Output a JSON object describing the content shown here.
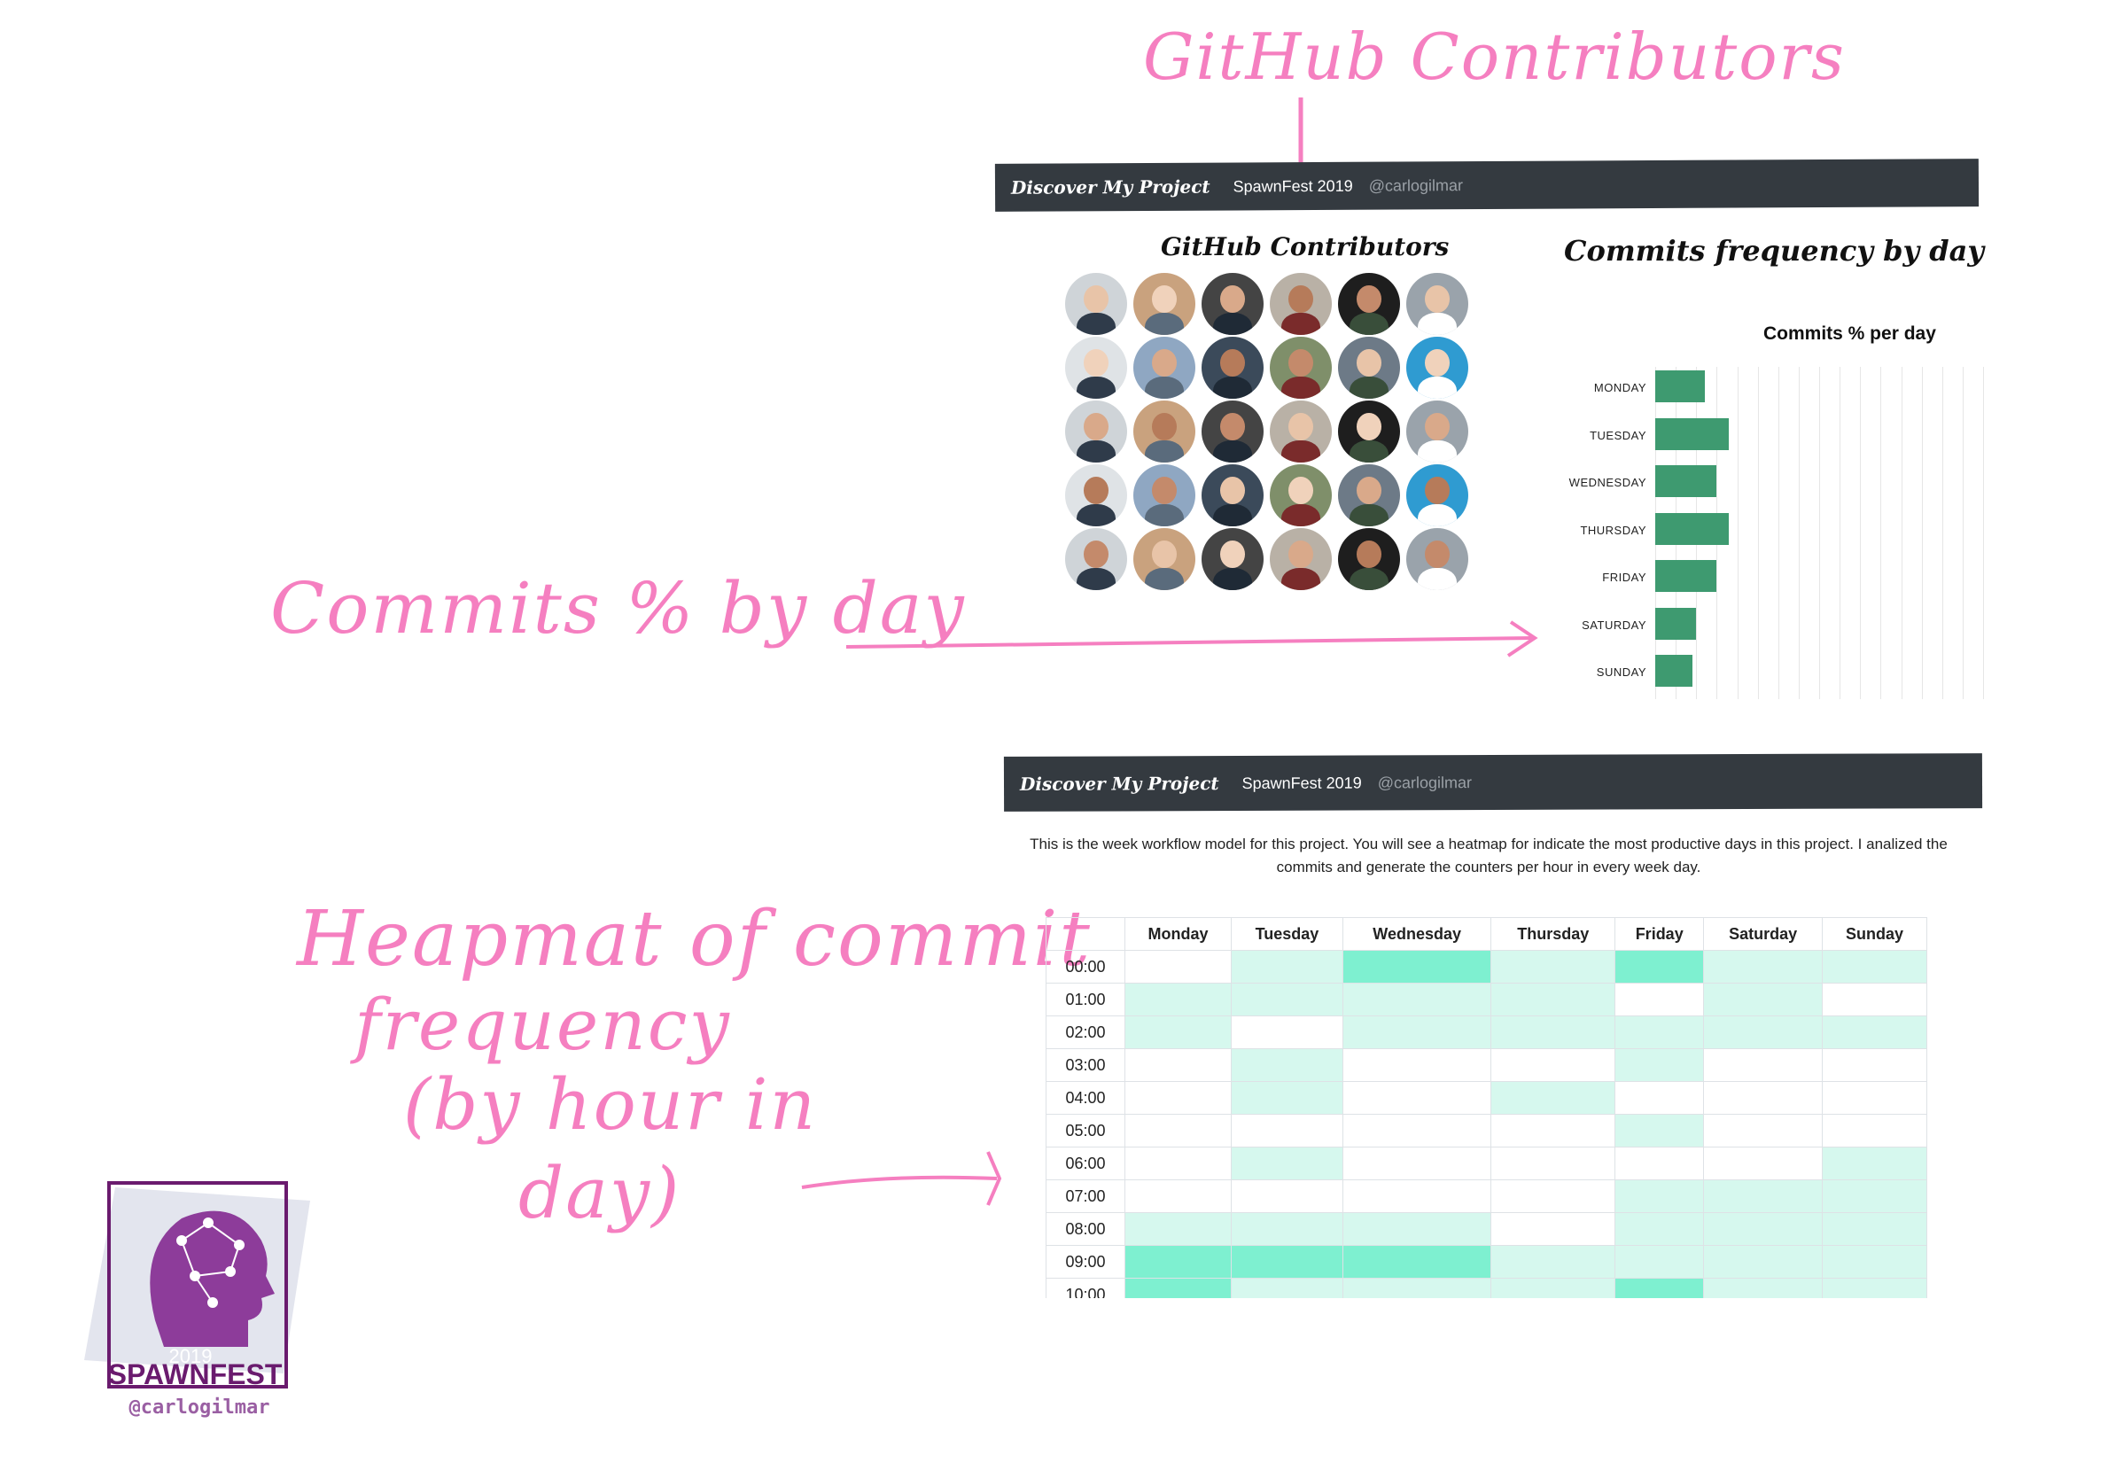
{
  "annotations": {
    "contributors_title": "GitHub Contributors",
    "commits_by_day": "Commits % by day",
    "heatmap_line1": "Heapmat of commit",
    "heatmap_line2": "frequency",
    "heatmap_line3": "(by hour in",
    "heatmap_line4": "day)"
  },
  "navbar": {
    "brand": "Discover My Project",
    "link1": "SpawnFest 2019",
    "link2": "@carlogilmar"
  },
  "contributors": {
    "title": "GitHub Contributors",
    "count": 30
  },
  "commits_panel": {
    "title": "Commits frequency by day"
  },
  "chart_data": {
    "type": "bar",
    "title": "Commits % per day",
    "orientation": "horizontal",
    "categories": [
      "MONDAY",
      "TUESDAY",
      "WEDNESDAY",
      "THURSDAY",
      "FRIDAY",
      "SATURDAY",
      "SUNDAY"
    ],
    "values": [
      12,
      18,
      15,
      18,
      15,
      10,
      9
    ],
    "xlim": [
      0,
      80
    ],
    "grid": true,
    "color": "#3e9a70"
  },
  "heatmap": {
    "intro": "This is the week workflow model for this project. You will see a heatmap for indicate the most productive days in this project. I analized the commits and generate the counters per hour in every week day.",
    "days": [
      "Monday",
      "Tuesday",
      "Wednesday",
      "Thursday",
      "Friday",
      "Saturday",
      "Sunday"
    ],
    "hours": [
      "00:00",
      "01:00",
      "02:00",
      "03:00",
      "04:00",
      "05:00",
      "06:00",
      "07:00",
      "08:00",
      "09:00",
      "10:00"
    ],
    "levels": [
      [
        0,
        1,
        2,
        1,
        2,
        1,
        1
      ],
      [
        1,
        1,
        1,
        1,
        0,
        1,
        0
      ],
      [
        1,
        0,
        1,
        1,
        1,
        1,
        1
      ],
      [
        0,
        1,
        0,
        0,
        1,
        0,
        0
      ],
      [
        0,
        1,
        0,
        1,
        0,
        0,
        0
      ],
      [
        0,
        0,
        0,
        0,
        1,
        0,
        0
      ],
      [
        0,
        1,
        0,
        0,
        0,
        0,
        1
      ],
      [
        0,
        0,
        0,
        0,
        1,
        1,
        1
      ],
      [
        1,
        1,
        1,
        0,
        1,
        1,
        1
      ],
      [
        2,
        2,
        2,
        1,
        1,
        1,
        1
      ],
      [
        2,
        1,
        1,
        1,
        2,
        1,
        1
      ]
    ],
    "colors": [
      "#ffffff",
      "#d6f8ee",
      "#7ef0d0"
    ]
  },
  "logo": {
    "year": "2019",
    "name": "SPAWNFEST",
    "handle": "@carlogilmar"
  }
}
